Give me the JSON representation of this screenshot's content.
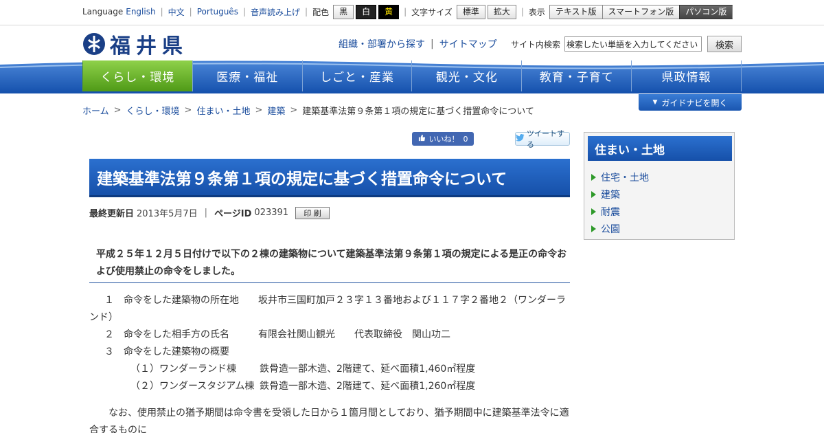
{
  "utility": {
    "language_label": "Language",
    "lang_english": "English",
    "lang_chinese": "中文",
    "lang_portuguese": "Português",
    "voice_reader": "音声読み上げ",
    "color_label": "配色",
    "color_black": "黒",
    "color_white": "白",
    "color_yellow": "黄",
    "fontsize_label": "文字サイズ",
    "fontsize_normal": "標準",
    "fontsize_large": "拡大",
    "display_label": "表示",
    "display_text": "テキスト版",
    "display_smartphone": "スマートフォン版",
    "display_pc": "パソコン版"
  },
  "header": {
    "logo_text": "福井県",
    "link_org": "組織・部署から探す",
    "link_sitemap": "サイトマップ",
    "search_label": "サイト内検索",
    "search_placeholder": "検索したい単語を入力してください",
    "search_button": "検索"
  },
  "nav": {
    "items": [
      "くらし・環境",
      "医療・福祉",
      "しごと・産業",
      "観光・文化",
      "教育・子育て",
      "県政情報"
    ]
  },
  "breadcrumb": {
    "items": [
      "ホーム",
      "くらし・環境",
      "住まい・土地",
      "建築"
    ],
    "current": "建築基準法第９条第１項の規定に基づく措置命令について"
  },
  "guide_button": "ガイドナビを開く",
  "social": {
    "like_label": "いいね！",
    "like_count": "0",
    "tweet_label": "ツイートする"
  },
  "page": {
    "title": "建築基準法第９条第１項の規定に基づく措置命令について",
    "updated_label": "最終更新日",
    "updated_date": "2013年5月7日",
    "pageid_label": "ページID",
    "pageid": "023391",
    "print_button": "印 刷",
    "lead": "平成２５年１２月５日付けで以下の２棟の建築物について建築基準法第９条第１項の規定による是正の命令および使用禁止の命令をしました。",
    "items": {
      "i1_num": "１",
      "i1_label": "命令をした建築物の所在地",
      "i1_value": "坂井市三国町加戸２３字１３番地および１１７字２番地２（ワンダーラ",
      "i1_cont": "ンド）",
      "i2_num": "２",
      "i2_label": "命令をした相手方の氏名",
      "i2_value": "有限会社関山観光　　代表取締役　関山功二",
      "i3_num": "３",
      "i3_label": "命令をした建築物の概要",
      "s1_label": "（１）ワンダーランド棟",
      "s1_value": "鉄骨造一部木造、2階建て、延べ面積1,460㎡程度",
      "s2_label": "（２）ワンダースタジアム棟",
      "s2_value": "鉄骨造一部木造、2階建て、延べ面積1,260㎡程度"
    },
    "note": "なお、使用禁止の猶予期間は命令書を受領した日から１箇月間としており、猶予期間中に建築基準法令に適合するものに"
  },
  "sidebar": {
    "title": "住まい・土地",
    "items": [
      "住宅・土地",
      "建築",
      "耐震",
      "公園"
    ]
  },
  "colors": {
    "brand_blue": "#1650a9",
    "nav_active_green": "#4f9a17",
    "link": "#1a4c9c"
  }
}
